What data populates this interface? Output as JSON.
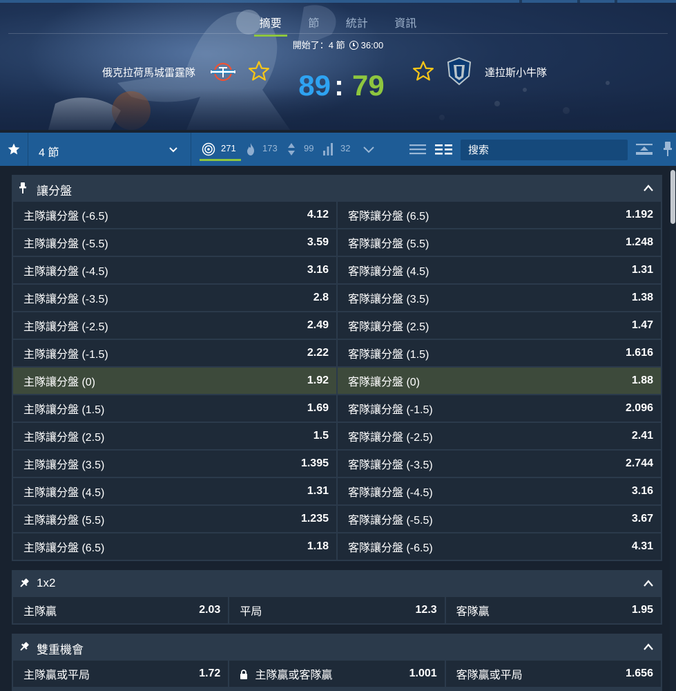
{
  "hero": {
    "tabs": [
      {
        "label": "摘要",
        "active": true
      },
      {
        "label": "節",
        "active": false
      },
      {
        "label": "統計",
        "active": false
      },
      {
        "label": "資訊",
        "active": false
      }
    ],
    "status": "開始了：4 節",
    "time": "36:00",
    "home_team": "俄克拉荷馬城雷霆隊",
    "away_team": "達拉斯小牛隊",
    "home_score": "89",
    "separator": ":",
    "away_score": "79",
    "home_logo_icon": "thunder-logo-icon",
    "away_logo_icon": "mavericks-logo-icon"
  },
  "toolbar": {
    "period": "4 節",
    "filters": [
      {
        "icon": "target-icon",
        "count": "271",
        "active": true
      },
      {
        "icon": "fire-icon",
        "count": "173",
        "active": false
      },
      {
        "icon": "updown-icon",
        "count": "99",
        "active": false
      },
      {
        "icon": "bars-icon",
        "count": "32",
        "active": false
      }
    ],
    "search_placeholder": "搜索"
  },
  "markets": [
    {
      "title": "讓分盤",
      "rows": [
        [
          {
            "label": "主隊讓分盤 (-6.5)",
            "odd": "4.12"
          },
          {
            "label": "客隊讓分盤 (6.5)",
            "odd": "1.192"
          }
        ],
        [
          {
            "label": "主隊讓分盤 (-5.5)",
            "odd": "3.59"
          },
          {
            "label": "客隊讓分盤 (5.5)",
            "odd": "1.248"
          }
        ],
        [
          {
            "label": "主隊讓分盤 (-4.5)",
            "odd": "3.16"
          },
          {
            "label": "客隊讓分盤 (4.5)",
            "odd": "1.31"
          }
        ],
        [
          {
            "label": "主隊讓分盤 (-3.5)",
            "odd": "2.8"
          },
          {
            "label": "客隊讓分盤 (3.5)",
            "odd": "1.38"
          }
        ],
        [
          {
            "label": "主隊讓分盤 (-2.5)",
            "odd": "2.49"
          },
          {
            "label": "客隊讓分盤 (2.5)",
            "odd": "1.47"
          }
        ],
        [
          {
            "label": "主隊讓分盤 (-1.5)",
            "odd": "2.22"
          },
          {
            "label": "客隊讓分盤 (1.5)",
            "odd": "1.616"
          }
        ],
        [
          {
            "label": "主隊讓分盤 (0)",
            "odd": "1.92",
            "highlight": true
          },
          {
            "label": "客隊讓分盤 (0)",
            "odd": "1.88",
            "highlight": true
          }
        ],
        [
          {
            "label": "主隊讓分盤 (1.5)",
            "odd": "1.69"
          },
          {
            "label": "客隊讓分盤 (-1.5)",
            "odd": "2.096"
          }
        ],
        [
          {
            "label": "主隊讓分盤 (2.5)",
            "odd": "1.5"
          },
          {
            "label": "客隊讓分盤 (-2.5)",
            "odd": "2.41"
          }
        ],
        [
          {
            "label": "主隊讓分盤 (3.5)",
            "odd": "1.395"
          },
          {
            "label": "客隊讓分盤 (-3.5)",
            "odd": "2.744"
          }
        ],
        [
          {
            "label": "主隊讓分盤 (4.5)",
            "odd": "1.31"
          },
          {
            "label": "客隊讓分盤 (-4.5)",
            "odd": "3.16"
          }
        ],
        [
          {
            "label": "主隊讓分盤 (5.5)",
            "odd": "1.235"
          },
          {
            "label": "客隊讓分盤 (-5.5)",
            "odd": "3.67"
          }
        ],
        [
          {
            "label": "主隊讓分盤 (6.5)",
            "odd": "1.18"
          },
          {
            "label": "客隊讓分盤 (-6.5)",
            "odd": "4.31"
          }
        ]
      ]
    },
    {
      "title": "1x2",
      "rows": [
        [
          {
            "label": "主隊贏",
            "odd": "2.03"
          },
          {
            "label": "平局",
            "odd": "12.3"
          },
          {
            "label": "客隊贏",
            "odd": "1.95"
          }
        ]
      ]
    },
    {
      "title": "雙重機會",
      "rows": [
        [
          {
            "label": "主隊贏或平局",
            "odd": "1.72"
          },
          {
            "label": "主隊贏或客隊贏",
            "odd": "1.001",
            "locked": true
          },
          {
            "label": "客隊贏或平局",
            "odd": "1.656"
          }
        ]
      ]
    }
  ],
  "colors": {
    "home_score": "#2ea3f2",
    "away_score": "#8ec63f",
    "accent": "#8ec63f",
    "toolbar": "#1e5c96",
    "star": "#f5c518"
  }
}
